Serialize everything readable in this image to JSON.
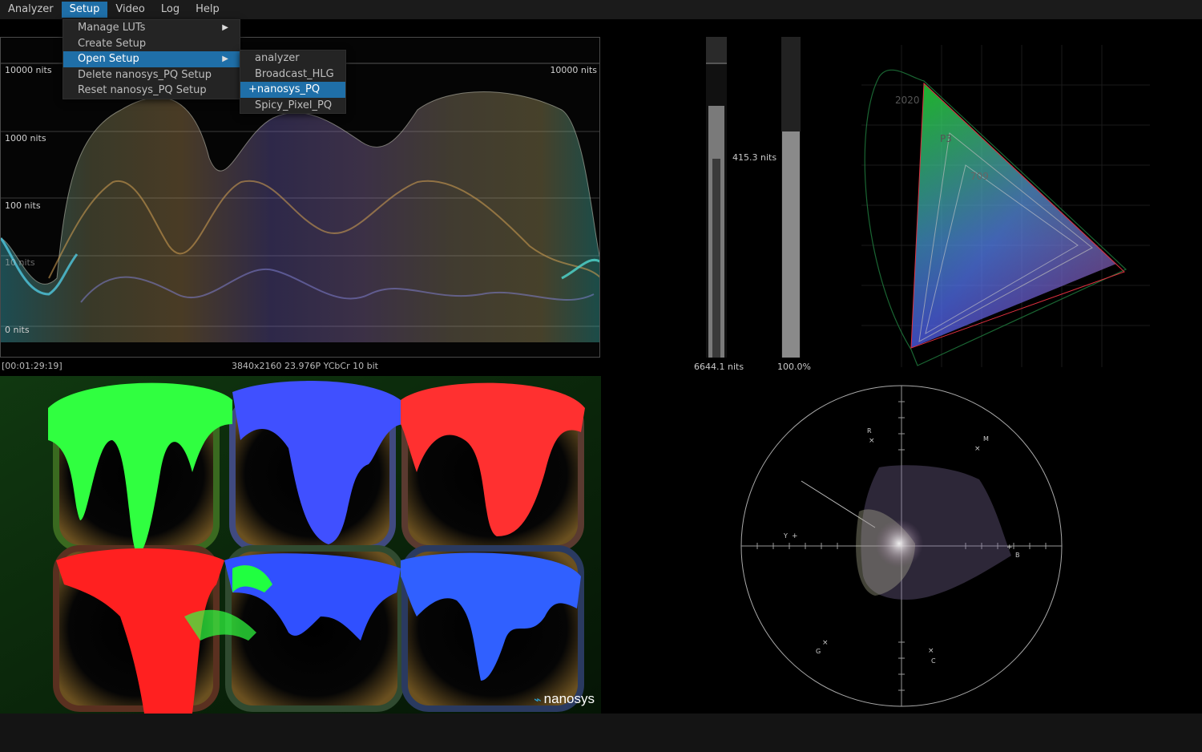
{
  "menubar": {
    "items": [
      {
        "label": "Analyzer",
        "active": false
      },
      {
        "label": "Setup",
        "active": true
      },
      {
        "label": "Video",
        "active": false
      },
      {
        "label": "Log",
        "active": false
      },
      {
        "label": "Help",
        "active": false
      }
    ]
  },
  "setup_menu": {
    "items": [
      {
        "label": "Manage LUTs",
        "submenu": true,
        "highlighted": false
      },
      {
        "label": "Create Setup",
        "submenu": false,
        "highlighted": false
      },
      {
        "label": "Open Setup",
        "submenu": true,
        "highlighted": true
      },
      {
        "label": "Delete nanosys_PQ Setup",
        "submenu": false,
        "highlighted": false
      },
      {
        "label": "Reset nanosys_PQ Setup",
        "submenu": false,
        "highlighted": false
      }
    ]
  },
  "open_setup_submenu": {
    "items": [
      {
        "label": "analyzer",
        "highlighted": false
      },
      {
        "label": "Broadcast_HLG",
        "highlighted": false
      },
      {
        "label": "+nanosys_PQ",
        "highlighted": true
      },
      {
        "label": "Spicy_Pixel_PQ",
        "highlighted": false
      }
    ]
  },
  "waveform": {
    "labels": [
      "10000 nits",
      "1000 nits",
      "100 nits",
      "10 nits",
      "0 nits"
    ],
    "right_label": "10000 nits"
  },
  "status": {
    "timecode": "[00:01:29:19]",
    "format": "3840x2160 23.976P YCbCr 10 bit"
  },
  "meters": {
    "level_value": "415.3 nits",
    "max_nits": "6644.1 nits",
    "percent": "100.0%",
    "level_fraction": 0.8,
    "peak_fraction": 0.7
  },
  "gamut": {
    "labels": [
      "2020",
      "P3",
      "709"
    ]
  },
  "vectorscope": {
    "targets": [
      "R",
      "M",
      "Y",
      "B",
      "G",
      "C"
    ]
  },
  "video": {
    "logo_text": "nanosys"
  },
  "colors": {
    "accent": "#1f6fa8",
    "menu_bg": "#242424",
    "menubar_bg": "#1b1b1b"
  }
}
